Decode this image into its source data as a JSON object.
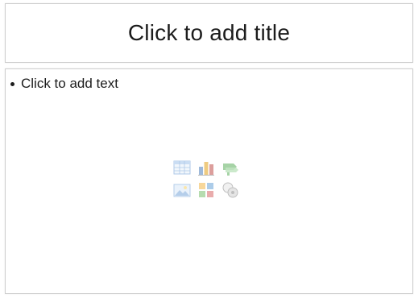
{
  "slide": {
    "title_placeholder": "Click to add title",
    "content_placeholder": "Click to add text"
  },
  "content_insert_icons": [
    "insert-table-icon",
    "insert-chart-icon",
    "insert-smartart-icon",
    "insert-picture-icon",
    "insert-clip-art-icon",
    "insert-media-clip-icon"
  ],
  "colors": {
    "border": "#cfcfcf",
    "text": "#1c1c1c"
  }
}
